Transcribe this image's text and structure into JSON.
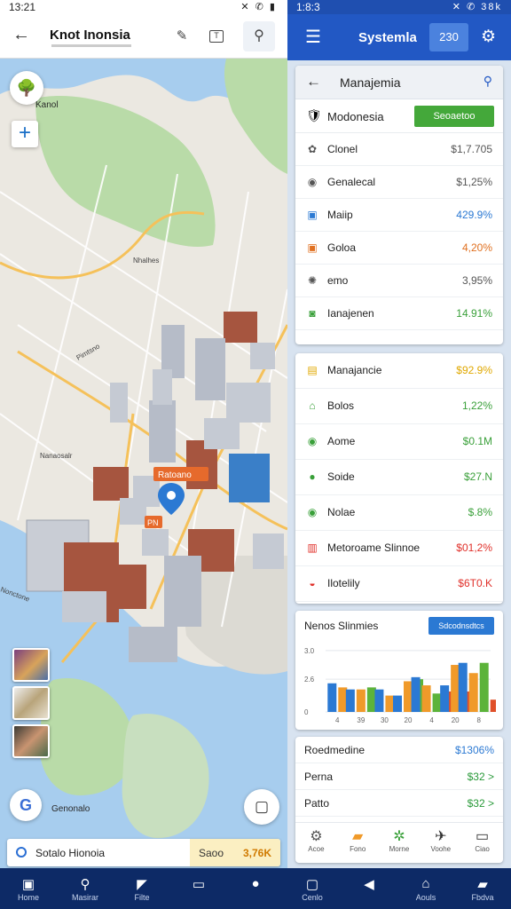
{
  "left_status": {
    "time": "13:21",
    "icons": "✕ ✆ ▮"
  },
  "left_header": {
    "back_glyph": "←",
    "title": "Knot Inonsia",
    "pin_glyph": "✎",
    "frame_glyph": "T",
    "search_glyph": "⚲"
  },
  "map": {
    "logo_glyph": "🌳",
    "zoom_glyph": "+",
    "label_top": "Kanol",
    "label_bottom": "Genonalo",
    "google_glyph": "G",
    "layers_glyph": "▢",
    "pin_label_1": "Ratoano",
    "pin_label_2": "PN",
    "street_labels": [
      "Nhalhes",
      "Pimtsno",
      "Nanaosalr",
      "Nonctone"
    ],
    "colors": {
      "water": "#a7cdee",
      "land": "#ebe8e1",
      "park": "#b9dba8",
      "road": "#f5c15a"
    }
  },
  "place_card": {
    "name": "Sotalo Hionoia",
    "label": "Saoo",
    "value": "3,76K"
  },
  "right_status": {
    "time": "1:8:3",
    "icons": "✕ ✆ 38k"
  },
  "right_header": {
    "menu_glyph": "☰",
    "title": "Systemla",
    "badge": "230",
    "gear_glyph": "⚙"
  },
  "card1": {
    "title": "Manajemia",
    "back_glyph": "←",
    "search_glyph": "⚲",
    "sub": {
      "icon": "🛡",
      "name": "Modonesia",
      "button": "Seoaetoo"
    },
    "rows": [
      {
        "icon": "✿",
        "name": "Clonel",
        "value": "$1,7.705",
        "color": "#555555"
      },
      {
        "icon": "◉",
        "name": "Genalecal",
        "value": "$1,25%",
        "color": "#555555"
      },
      {
        "icon": "▣",
        "name": "Maiip",
        "value": "429.9%",
        "color": "#2b79d3"
      },
      {
        "icon": "▣",
        "name": "Goloa",
        "value": "4,20%",
        "color": "#e07020"
      },
      {
        "icon": "✺",
        "name": "emo",
        "value": "3,95%",
        "color": "#555555"
      },
      {
        "icon": "◙",
        "name": "Ianajenen",
        "value": "14.91%",
        "color": "#3aa03a"
      }
    ]
  },
  "card2": {
    "rows": [
      {
        "icon": "▤",
        "name": "Manajancie",
        "value": "$92.9%",
        "color": "#e0a800"
      },
      {
        "icon": "⌂",
        "name": "Bolos",
        "value": "1,22%",
        "color": "#3aa03a"
      },
      {
        "icon": "◉",
        "name": "Aome",
        "value": "$0.1M",
        "color": "#3aa03a"
      },
      {
        "icon": "●",
        "name": "Soide",
        "value": "$27.N",
        "color": "#3aa03a"
      },
      {
        "icon": "◉",
        "name": "Nolae",
        "value": "$.8%",
        "color": "#3aa03a"
      },
      {
        "icon": "▥",
        "name": "Metoroame Slinnoe",
        "value": "$01,2%",
        "color": "#e0302a"
      },
      {
        "icon": "◒",
        "name": "Ilotelily",
        "value": "$6T0.K",
        "color": "#e0302a"
      }
    ]
  },
  "card3": {
    "title": "Nenos Slinmies",
    "button": "Sdcodnsdtcs"
  },
  "chart_data": {
    "type": "bar",
    "categories": [
      "4",
      "39",
      "39",
      "20",
      "4",
      "20",
      "8"
    ],
    "x_tick_labels": [
      "4",
      "39",
      "30",
      "20",
      "4",
      "20",
      "8"
    ],
    "y_tick_labels": [
      "0",
      "2.6",
      "3.0"
    ],
    "ylim": [
      0,
      3.3
    ],
    "series": [
      {
        "values": [
          1.4,
          1.1,
          1.1,
          0.8,
          1.7,
          1.3,
          2.4
        ]
      },
      {
        "values": [
          1.2,
          1.1,
          0.8,
          1.5,
          1.3,
          2.3,
          1.9
        ]
      },
      {
        "values": [
          0,
          1.2,
          0,
          1.6,
          0.9,
          0,
          2.4
        ]
      },
      {
        "values": [
          0,
          0,
          0,
          0,
          1.0,
          1.0,
          0.6
        ]
      }
    ],
    "colors": [
      "#2b79d3",
      "#f09a2a",
      "#5cb33a",
      "#e0502a"
    ]
  },
  "card4": {
    "lines": [
      {
        "name": "Roedmedine",
        "value": "$1306%"
      },
      {
        "name": "Perna",
        "value": "$32 >"
      },
      {
        "name": "Patto",
        "value": "$32 >"
      }
    ],
    "tabs": [
      {
        "icon": "⚙",
        "label": "Acoe",
        "color": "#555555"
      },
      {
        "icon": "▰",
        "label": "Fono",
        "color": "#f09a2a"
      },
      {
        "icon": "✲",
        "label": "Morne",
        "color": "#3aa03a"
      },
      {
        "icon": "✈",
        "label": "Voohe",
        "color": "#333333"
      },
      {
        "icon": "▭",
        "label": "Ciao",
        "color": "#333333"
      }
    ]
  },
  "bottom_nav": [
    {
      "icon": "▣",
      "label": "Home"
    },
    {
      "icon": "⚲",
      "label": "Masirar"
    },
    {
      "icon": "◤",
      "label": "Filte"
    },
    {
      "icon": "▭",
      "label": ""
    },
    {
      "icon": "●",
      "label": ""
    },
    {
      "icon": "▢",
      "label": "Cenlo"
    },
    {
      "icon": "◀",
      "label": ""
    },
    {
      "icon": "⌂",
      "label": "Aouls"
    },
    {
      "icon": "▰",
      "label": "Fbdva"
    }
  ]
}
